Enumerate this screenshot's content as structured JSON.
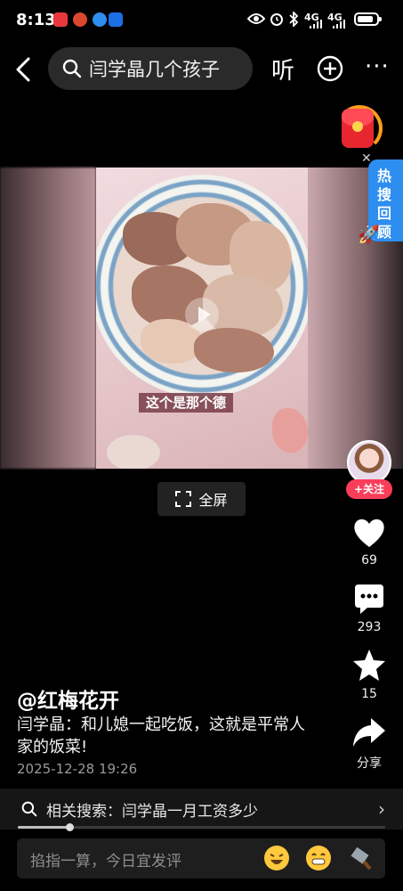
{
  "status_bar": {
    "time": "8:13",
    "network_1": "4G",
    "network_2": "4G"
  },
  "top_bar": {
    "search_text": "闫学晶几个孩子",
    "listen_label": "听",
    "more_label": "···"
  },
  "video": {
    "caption": "这个是那个德",
    "fullscreen_label": "全屏"
  },
  "widgets": {
    "hot_review_label": "热搜回顾",
    "follow_label": "+关注"
  },
  "actions": {
    "like_count": "69",
    "comment_count": "293",
    "favorite_count": "15",
    "share_label": "分享"
  },
  "post": {
    "username": "@红梅花开",
    "description": "闫学晶：和儿媳一起吃饭，这就是平常人家的饭菜!",
    "date": "2025-12-28 19:26"
  },
  "related_search": {
    "text": "相关搜索：闫学晶一月工资多少",
    "progress": 0.14
  },
  "comment_bar": {
    "placeholder": "掐指一算，今日宜发评"
  },
  "colors": {
    "follow": "#fa3e5a",
    "hot_review": "#2d8ef0",
    "red_packet": "#e8262f"
  }
}
